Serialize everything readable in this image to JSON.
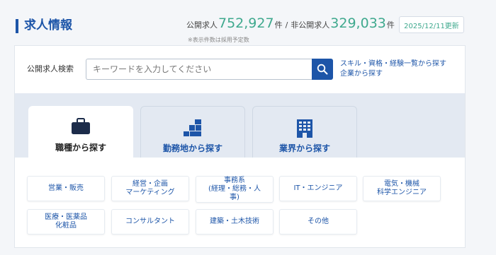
{
  "header": {
    "title": "求人情報",
    "public_label": "公開求人",
    "public_count": "752,927",
    "unit1": "件",
    "separator": "/",
    "private_label": "非公開求人",
    "private_count": "329,033",
    "unit2": "件",
    "updated": "2025/12/11更新",
    "note": "※表示件数は採用予定数"
  },
  "search": {
    "label": "公開求人検索",
    "placeholder": "キーワードを入力してください",
    "links": [
      "スキル・資格・経験一覧から探す",
      "企業から探す"
    ]
  },
  "tabs": [
    {
      "label": "職種から探す",
      "icon": "briefcase-icon"
    },
    {
      "label": "勤務地から探す",
      "icon": "map-blocks-icon"
    },
    {
      "label": "業界から探す",
      "icon": "building-icon"
    }
  ],
  "categories": [
    "営業・販売",
    "経営・企画\nマーケティング",
    "事務系\n(経理・総務・人\n事)",
    "IT・エンジニア",
    "電気・機械\n科学エンジニア",
    "医療・医薬品\n化粧品",
    "コンサルタント",
    "建築・土木技術",
    "その他"
  ],
  "colors": {
    "brand_blue": "#1d55a8",
    "count_green": "#3fa98e",
    "band_bg": "#e3e9f2"
  }
}
